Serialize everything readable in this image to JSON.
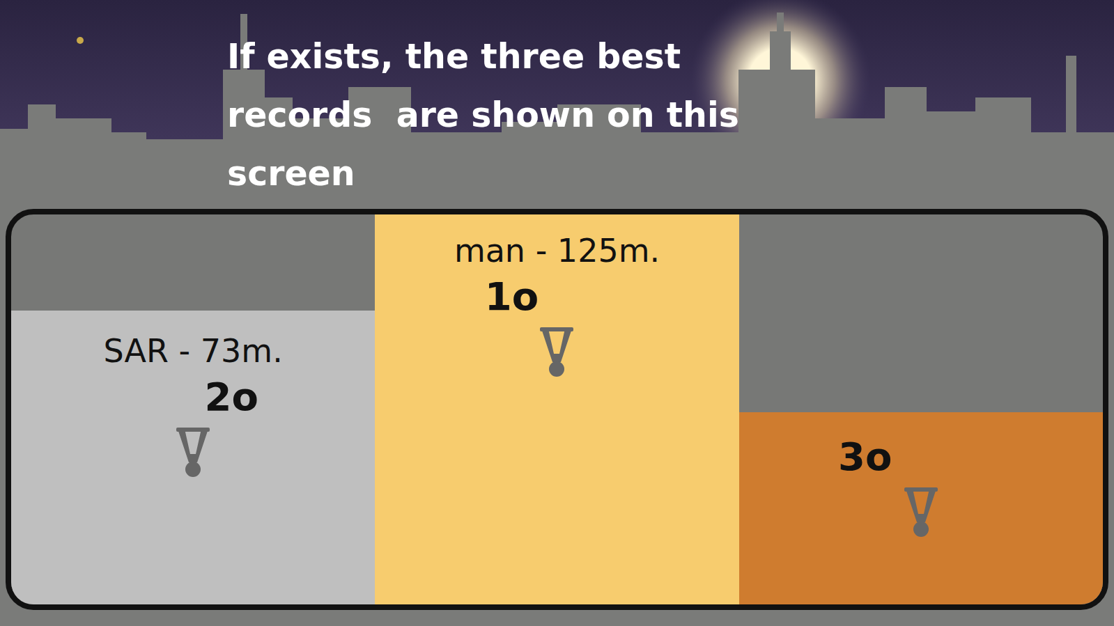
{
  "screen": {
    "caption": "If exists, the three best records  are shown on this screen"
  },
  "podium": [
    {
      "label": "2o",
      "record": "SAR - 73m.",
      "color": "#bfbfbf"
    },
    {
      "label": "1o",
      "record": "man - 125m.",
      "color": "#f7cc6e"
    },
    {
      "label": "3o",
      "record": "",
      "color": "#cf7c2f"
    }
  ]
}
